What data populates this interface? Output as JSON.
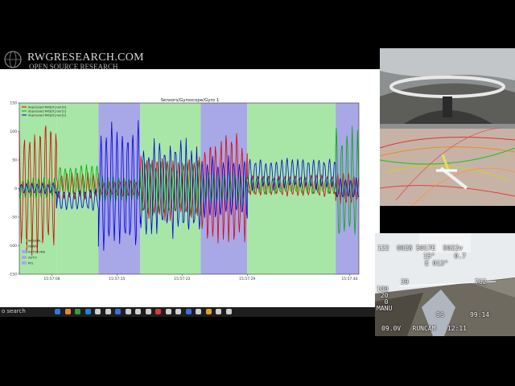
{
  "watermark": {
    "title": "RWGRESEARCH.COM",
    "subtitle": "OPEN SOURCE RESEARCH"
  },
  "colors": {
    "mode_manual": "#a8e6a8",
    "mode_auto": "#a8a8e6",
    "gyro0": "#dd0000",
    "gyro1": "#00aa00",
    "gyro2": "#0000dd",
    "target": "#bb00bb"
  },
  "chart_data": {
    "type": "line",
    "title": "Sensors/Gyroscope/Gyro 1",
    "xlabel": "",
    "ylabel": "",
    "ylim": [
      -150,
      150
    ],
    "yticks": [
      150,
      100,
      50,
      0,
      -50,
      -100,
      -150
    ],
    "xlim": [
      "15:57:04.5",
      "15:57:41"
    ],
    "xticks": [
      "15:57:08",
      "15:57:15",
      "15:57:22",
      "15:57:29",
      "15:57:40"
    ],
    "legend": [
      "depressed RKS[0].Gyr[0]",
      "depressed RKS[0].Gyr[1]",
      "depressed RKS[0].Gyr[2]",
      "MANUAL",
      "FBWA",
      "AUTOTUNE",
      "AUTO",
      "RTL"
    ],
    "legend_position": "bottom-left",
    "grid": false,
    "mode_bands": [
      {
        "start": "15:57:04.5",
        "end": "15:57:08.5",
        "mode": "MANUAL"
      },
      {
        "start": "15:57:08.5",
        "end": "15:57:13",
        "mode": "MANUAL"
      },
      {
        "start": "15:57:13",
        "end": "15:57:17.5",
        "mode": "AUTOTUNE"
      },
      {
        "start": "15:57:17.5",
        "end": "15:57:24",
        "mode": "MANUAL"
      },
      {
        "start": "15:57:24",
        "end": "15:57:29",
        "mode": "AUTOTUNE"
      },
      {
        "start": "15:57:29",
        "end": "15:57:38.5",
        "mode": "MANUAL"
      },
      {
        "start": "15:57:38.5",
        "end": "15:57:41",
        "mode": "AUTOTUNE"
      }
    ],
    "series": [
      {
        "name": "depressed RKS[0].Gyr[0]",
        "segments": [
          {
            "from": "15:57:04.5",
            "to": "15:57:08.5",
            "amp": 125,
            "mean": 0
          },
          {
            "from": "15:57:08.5",
            "to": "15:57:13",
            "amp": 25,
            "mean": 5
          },
          {
            "from": "15:57:13",
            "to": "15:57:17.5",
            "amp": 15,
            "mean": 0
          },
          {
            "from": "15:57:17.5",
            "to": "15:57:24",
            "amp": 60,
            "mean": 0
          },
          {
            "from": "15:57:24",
            "to": "15:57:29",
            "amp": 100,
            "mean": 0
          },
          {
            "from": "15:57:29",
            "to": "15:57:38.5",
            "amp": 20,
            "mean": 5
          },
          {
            "from": "15:57:38.5",
            "to": "15:57:41",
            "amp": 30,
            "mean": 0
          }
        ]
      },
      {
        "name": "depressed RKS[0].Gyr[1]",
        "segments": [
          {
            "from": "15:57:04.5",
            "to": "15:57:08.5",
            "amp": 20,
            "mean": 0
          },
          {
            "from": "15:57:08.5",
            "to": "15:57:13",
            "amp": 30,
            "mean": 15
          },
          {
            "from": "15:57:13",
            "to": "15:57:17.5",
            "amp": 25,
            "mean": 0
          },
          {
            "from": "15:57:17.5",
            "to": "15:57:24",
            "amp": 50,
            "mean": 0
          },
          {
            "from": "15:57:24",
            "to": "15:57:29",
            "amp": 30,
            "mean": 0
          },
          {
            "from": "15:57:29",
            "to": "15:57:38.5",
            "amp": 15,
            "mean": 5
          },
          {
            "from": "15:57:38.5",
            "to": "15:57:41",
            "amp": 110,
            "mean": 0
          }
        ]
      },
      {
        "name": "depressed RKS[0].Gyr[2]",
        "segments": [
          {
            "from": "15:57:04.5",
            "to": "15:57:08.5",
            "amp": 10,
            "mean": 0
          },
          {
            "from": "15:57:08.5",
            "to": "15:57:13",
            "amp": 20,
            "mean": -20
          },
          {
            "from": "15:57:13",
            "to": "15:57:17.5",
            "amp": 120,
            "mean": 0
          },
          {
            "from": "15:57:17.5",
            "to": "15:57:24",
            "amp": 90,
            "mean": 0
          },
          {
            "from": "15:57:24",
            "to": "15:57:29",
            "amp": 60,
            "mean": 0
          },
          {
            "from": "15:57:29",
            "to": "15:57:38.5",
            "amp": 30,
            "mean": 25
          },
          {
            "from": "15:57:38.5",
            "to": "15:57:41",
            "amp": 20,
            "mean": 0
          }
        ]
      }
    ]
  },
  "taskbar": {
    "search_label": "o search",
    "icons": [
      "#2d7bd6",
      "#e3873a",
      "#3e9a3e",
      "#2d7bd6",
      "#cfcfcf",
      "#cfcfcf",
      "#3f6fd6",
      "#cfcfcf",
      "#cfcfcf",
      "#cfcfcf",
      "#d43a3a",
      "#cfcfcf",
      "#cfcfcf",
      "#3f6fd6",
      "#cfcfcf",
      "#e0a030",
      "#cfcfcf",
      "#cfcfcf"
    ]
  },
  "osd": {
    "top_line": "122  0028 5017E  D022v",
    "line2": "15°     0.7",
    "line3": "E 013°",
    "left_speed": "39",
    "right_alt": "762",
    "left_vals": "100\n 20\n  0\nMANU",
    "center_heading": "96",
    "right_dist": "99:14",
    "bottom_line": "09.0V   RUNCAM   12:11"
  }
}
